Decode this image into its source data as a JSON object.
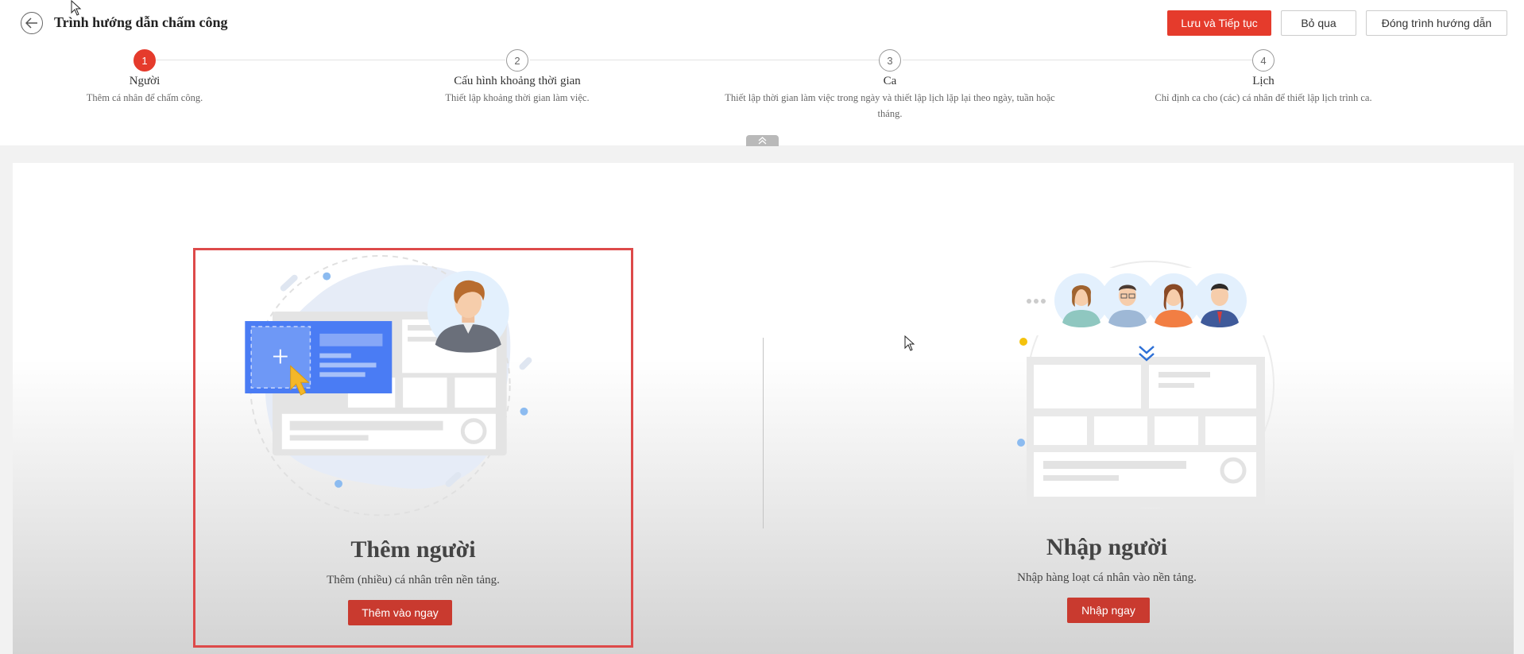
{
  "header": {
    "title": "Trình hướng dẫn chấm công",
    "save_continue_label": "Lưu và Tiếp tục",
    "skip_label": "Bỏ qua",
    "close_label": "Đóng trình hướng dẫn"
  },
  "steps": [
    {
      "number": "1",
      "title": "Người",
      "desc": "Thêm cá nhân để chấm công.",
      "active": true
    },
    {
      "number": "2",
      "title": "Cấu hình khoảng thời gian",
      "desc": "Thiết lập khoảng thời gian làm việc.",
      "active": false
    },
    {
      "number": "3",
      "title": "Ca",
      "desc": "Thiết lập thời gian làm việc trong ngày và thiết lập lịch lặp lại theo ngày, tuần hoặc tháng.",
      "active": false
    },
    {
      "number": "4",
      "title": "Lịch",
      "desc": "Chỉ định ca cho (các) cá nhân để thiết lập lịch trình ca.",
      "active": false
    }
  ],
  "cards": {
    "add": {
      "title": "Thêm người",
      "desc": "Thêm (nhiều) cá nhân trên nền tảng.",
      "button_label": "Thêm vào ngay"
    },
    "import": {
      "title": "Nhập người",
      "desc": "Nhập hàng loạt cá nhân vào nền tảng.",
      "button_label": "Nhập ngay"
    }
  },
  "colors": {
    "accent": "#e53b2c",
    "card_button": "#c93a2f",
    "highlight_border": "#dd4a4a",
    "illustration_blue": "#4a7cf4"
  },
  "icons": {
    "back": "arrow-left-circle-icon",
    "collapse": "chevron-double-up-icon",
    "import_arrow": "chevron-double-down-icon"
  }
}
